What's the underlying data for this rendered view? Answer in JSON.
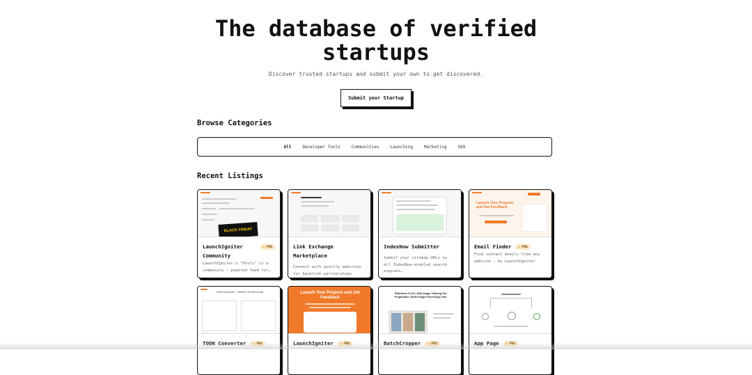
{
  "hero": {
    "title": "The database of verified startups",
    "subtitle": "Discover trusted startups and submit your own to get discovered.",
    "cta": "Submit your Startup"
  },
  "categories": {
    "heading": "Browse Categories",
    "items": [
      "All",
      "Developer Tools",
      "Communities",
      "Launching",
      "Marketing",
      "SEO"
    ],
    "active": "All"
  },
  "listings": {
    "heading": "Recent Listings",
    "pro_label": "PRO",
    "items": [
      {
        "title": "LaunchIgniter Community",
        "desc": "LaunchIgniter's \"Posts\" is a community — powered feed for…",
        "pro": true,
        "thumb_text": "BLACK FRIDAY"
      },
      {
        "title": "Link Exchange Marketplace",
        "desc": "Connect with quality websites for backlink partnerships",
        "pro": false,
        "thumb_text": ""
      },
      {
        "title": "IndexNow Submitter",
        "desc": "Submit your sitemap URLs to all IndexNow-enabled search engines…",
        "pro": false,
        "thumb_text": ""
      },
      {
        "title": "Email Finder",
        "desc": "Find contact emails from any website - by LaunchIgniter",
        "pro": true,
        "thumb_text": "Launch Your Projects and Get Feedback"
      },
      {
        "title": "TOON Converter",
        "desc": "",
        "pro": true,
        "thumb_text": "TOON Converter - JSON to TOON Format"
      },
      {
        "title": "LaunchIgniter",
        "desc": "",
        "pro": true,
        "thumb_text": "Launch Your Projects and Get Feedback"
      },
      {
        "title": "BatchCropper",
        "desc": "",
        "pro": true,
        "thumb_text": "Effortless FLUX LoRA Image Training Set Preparation | Bulk Image Processing Tool"
      },
      {
        "title": "App Page",
        "desc": "",
        "pro": true,
        "thumb_text": ""
      }
    ]
  },
  "colors": {
    "accent": "#f07a2a",
    "pro_bg": "#fde8c8",
    "border": "#111111"
  }
}
